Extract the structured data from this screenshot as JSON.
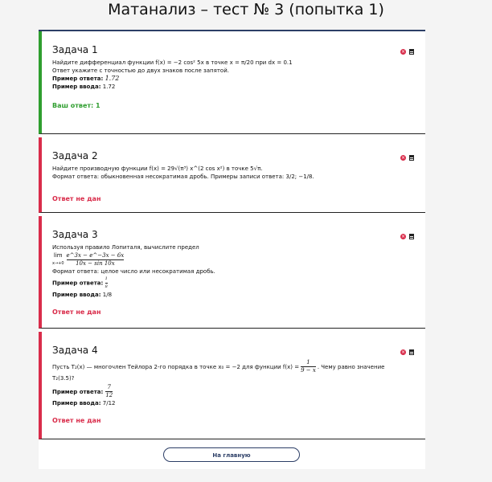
{
  "title": "Матанализ – тест № 3 (попытка 1)",
  "tasks": [
    {
      "title": "Задача 1",
      "lines": [
        "Найдите дифференциал функции f(x) = −2 cos² 5x в точке x = π/20 при dx = 0.1",
        "Ответ укажите с точностью до двух знаков после запятой."
      ],
      "example_answer_label": "Пример ответа:",
      "example_answer_value": "1.72",
      "example_input_label": "Пример ввода:",
      "example_input_value": "1.72",
      "result": "Ваш ответ: 1",
      "status": "correct"
    },
    {
      "title": "Задача 2",
      "lines": [
        "Найдите производную функции f(x) = 29√(π³) x^(2 cos x²) в точке 5√π.",
        "Формат ответа: обыкновенная несократимая дробь. Примеры записи ответа: 3/2; −1/8."
      ],
      "result": "Ответ не дан",
      "status": "wrong"
    },
    {
      "title": "Задача 3",
      "lines": [
        "Используя правило Лопиталя, вычислите предел"
      ],
      "limit_num": "e^3x − e^−3x − 6x",
      "limit_den": "10x − sin 10x",
      "limit_sub": "x→+0",
      "limit_word": "lim",
      "format_line": "Формат ответа: целое число или несократимая дробь.",
      "example_answer_label": "Пример ответа:",
      "example_answer_num": "1",
      "example_answer_den": "8",
      "example_input_label": "Пример ввода:",
      "example_input_value": "1/8",
      "result": "Ответ не дан",
      "status": "wrong"
    },
    {
      "title": "Задача 4",
      "line_a": "Пусть T₂(x) — многочлен Тейлора 2-го порядка в точке x₀ = −2 для функции f(x) =",
      "frac_num": "1",
      "frac_den": "9 − x",
      "line_b": ". Чему равно значение",
      "line_c": "T₂(3.5)?",
      "example_answer_label": "Пример ответа:",
      "example_answer_num": "7",
      "example_answer_den": "12",
      "example_input_label": "Пример ввода:",
      "example_input_value": "7/12",
      "result": "Ответ не дан",
      "status": "wrong"
    }
  ],
  "home_button": "На главную",
  "colors": {
    "correct": "#2f9e2f",
    "wrong": "#d92c4a",
    "accent": "#2c3e66"
  }
}
